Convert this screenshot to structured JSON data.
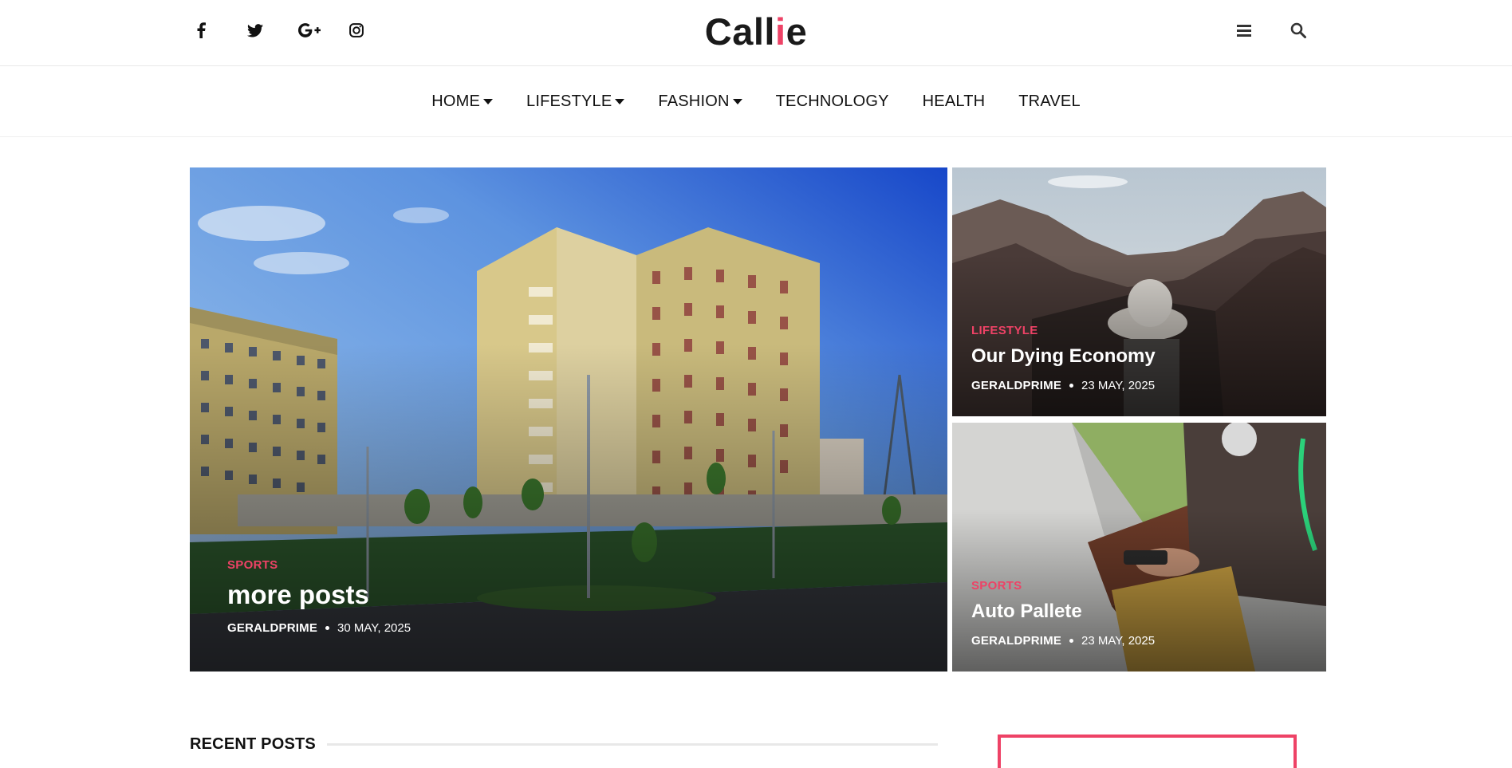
{
  "site": {
    "logo_main": "Call",
    "logo_accent": "i",
    "logo_end": "e",
    "accent_color": "#ee4266"
  },
  "header": {
    "social_icons": [
      "facebook-icon",
      "twitter-icon",
      "google-plus-icon",
      "instagram-icon"
    ],
    "right_icons": [
      "menu-icon",
      "search-icon"
    ]
  },
  "nav": {
    "items": [
      {
        "label": "HOME",
        "has_dropdown": true
      },
      {
        "label": "LIFESTYLE",
        "has_dropdown": true
      },
      {
        "label": "FASHION",
        "has_dropdown": true
      },
      {
        "label": "TECHNOLOGY",
        "has_dropdown": false
      },
      {
        "label": "HEALTH",
        "has_dropdown": false
      },
      {
        "label": "TRAVEL",
        "has_dropdown": false
      }
    ]
  },
  "featured": {
    "main": {
      "category": "SPORTS",
      "title": "more posts",
      "author": "GERALDPRIME",
      "date": "30 MAY, 2025"
    },
    "side1": {
      "category": "LIFESTYLE",
      "title": "Our Dying Economy",
      "author": "GERALDPRIME",
      "date": "23 MAY, 2025"
    },
    "side2": {
      "category": "SPORTS",
      "title": "Auto Pallete",
      "author": "GERALDPRIME",
      "date": "23 MAY, 2025"
    }
  },
  "recent": {
    "title": "RECENT POSTS"
  }
}
